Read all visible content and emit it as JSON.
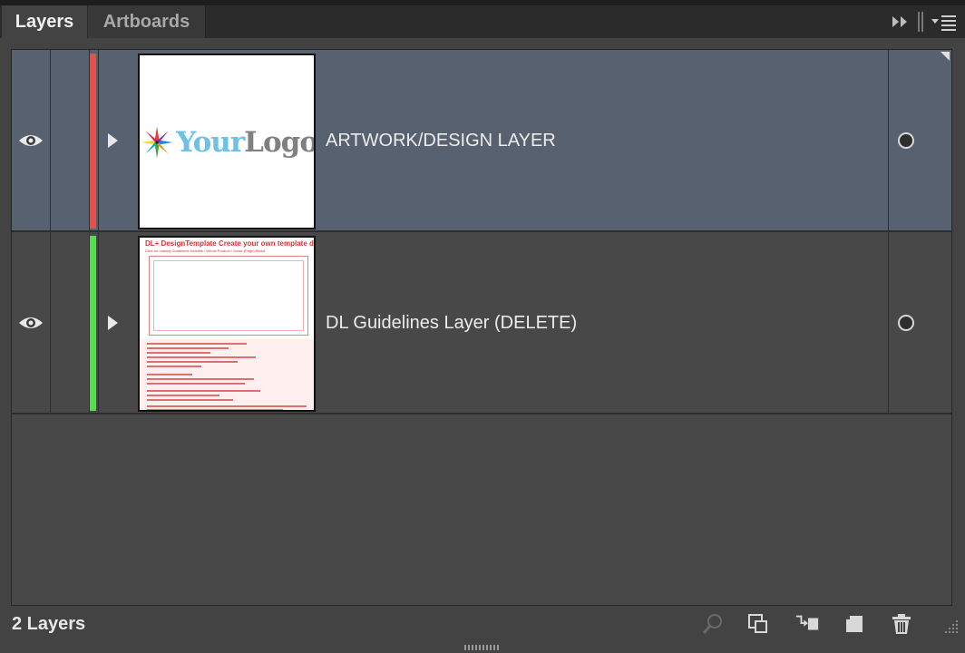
{
  "tabs": [
    {
      "label": "Layers",
      "active": true
    },
    {
      "label": "Artboards",
      "active": false
    }
  ],
  "tabbar_icons": [
    "collapse-panel-icon",
    "panel-menu-icon"
  ],
  "layers": [
    {
      "name": "ARTWORK/DESIGN LAYER",
      "visible": true,
      "color": "#f04b4b",
      "selected": true,
      "thumbnail": {
        "logo_your": "Your",
        "logo_logo": "Logo"
      }
    },
    {
      "name": "DL Guidelines Layer (DELETE)",
      "visible": true,
      "color": "#4fe04a",
      "selected": false,
      "thumbnail": {
        "title": "DL+ DesignTemplate  Create your own template design in full colour",
        "subtitle": "Click for making Guidelines Invisible / Whole Product / Guide (Page) Bleed"
      }
    }
  ],
  "footer": {
    "layer_count": "2 Layers",
    "icons": [
      "locate-object-icon",
      "make-clipping-mask-icon",
      "create-sublayer-icon",
      "create-new-layer-icon",
      "delete-layer-icon"
    ]
  },
  "colors": {
    "selected_row": "#58616f",
    "panel": "#434343",
    "list": "#484848"
  }
}
